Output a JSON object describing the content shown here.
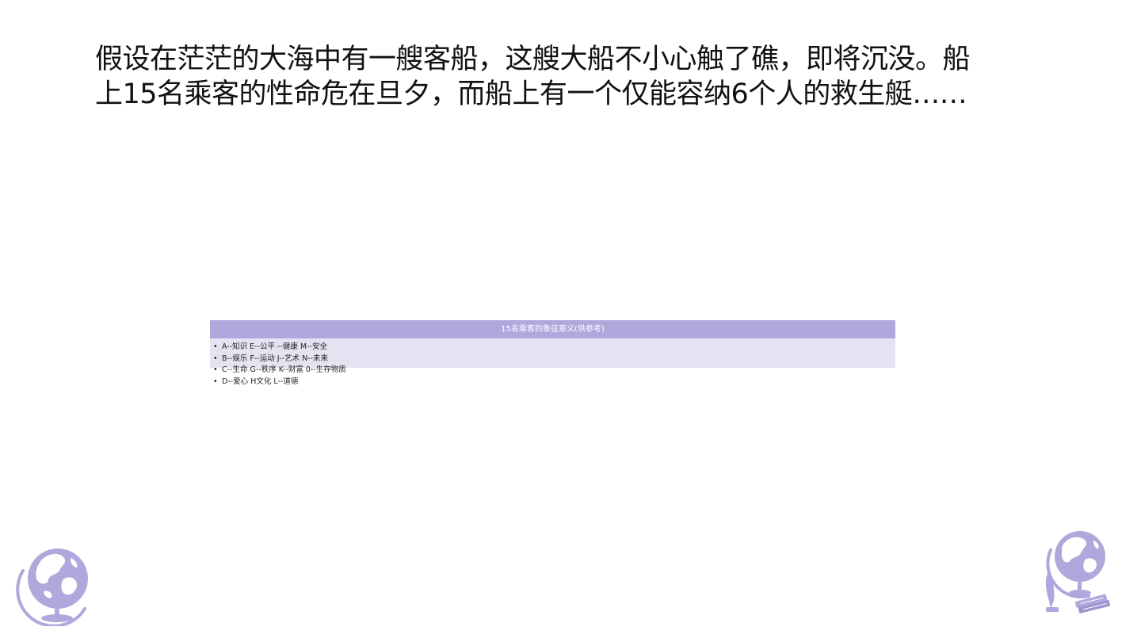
{
  "heading": {
    "line1": "假设在茫茫的大海中有一艘客船，这艘大船不小心触了礁，即将沉没。船",
    "line2": "上15名乘客的性命危在旦夕，而船上有一个仅能容纳6个人的救生艇……"
  },
  "table": {
    "header": "15名乘客的象征意义(供参考)",
    "bullet_symbol": "•",
    "items": [
      "A--知识 E--公平 --健康 M--安全",
      "B--娱乐 F--运动 J--艺术 N--未来",
      "C--生命 G--秩序 K--财富 0--生存物质",
      "D--爱心 H文化 L--道德"
    ]
  },
  "colors": {
    "accent": "#b0a7dc",
    "accent_light": "#e5e3f2",
    "text": "#111111"
  },
  "icons": {
    "left": "globe-icon",
    "right": "globe-with-books-icon"
  }
}
